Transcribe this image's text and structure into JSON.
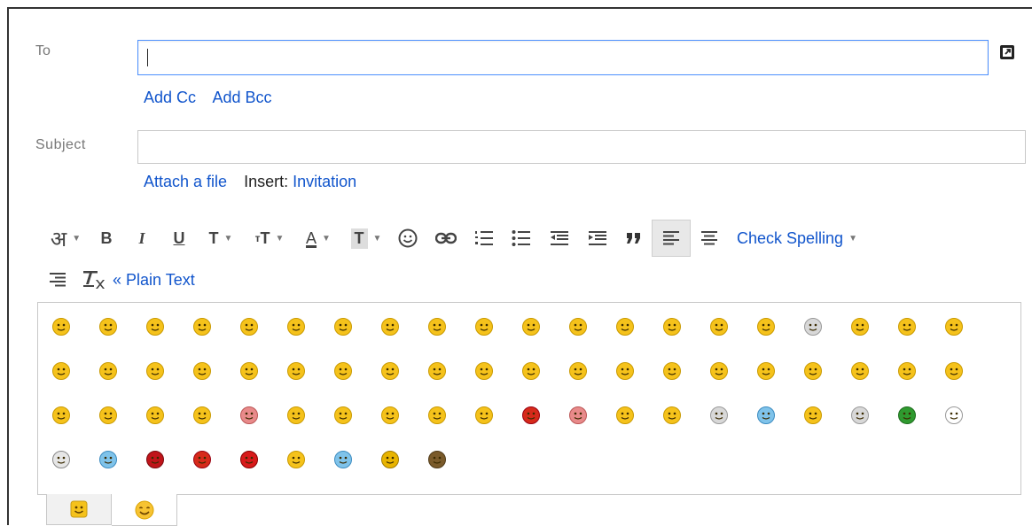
{
  "compose": {
    "to_label": "To",
    "subject_label": "Subject",
    "add_cc": "Add Cc",
    "add_bcc": "Add Bcc",
    "attach_file": "Attach a file",
    "insert_label": "Insert:",
    "invitation": "Invitation",
    "to_value": "",
    "subject_value": ""
  },
  "toolbar": {
    "input_tools": "अ",
    "bold": "B",
    "italic": "I",
    "underline": "U",
    "font": "T",
    "size": "T",
    "text_color": "A",
    "highlight": "T",
    "check_spelling": "Check Spelling",
    "plain_text": "« Plain Text",
    "icons": [
      "emoji-icon",
      "link-icon",
      "numbered-list-icon",
      "bulleted-list-icon",
      "indent-less-icon",
      "indent-more-icon",
      "quote-icon",
      "align-left-icon",
      "align-center-icon",
      "align-right-icon",
      "remove-formatting-icon"
    ]
  },
  "emoji_tabs": [
    "classic-emoticons-tab",
    "smileys-tab"
  ],
  "colors": {
    "link": "#1155cc",
    "focus_border": "#4d90fe",
    "emoji_yellow": "#f5c21b"
  }
}
